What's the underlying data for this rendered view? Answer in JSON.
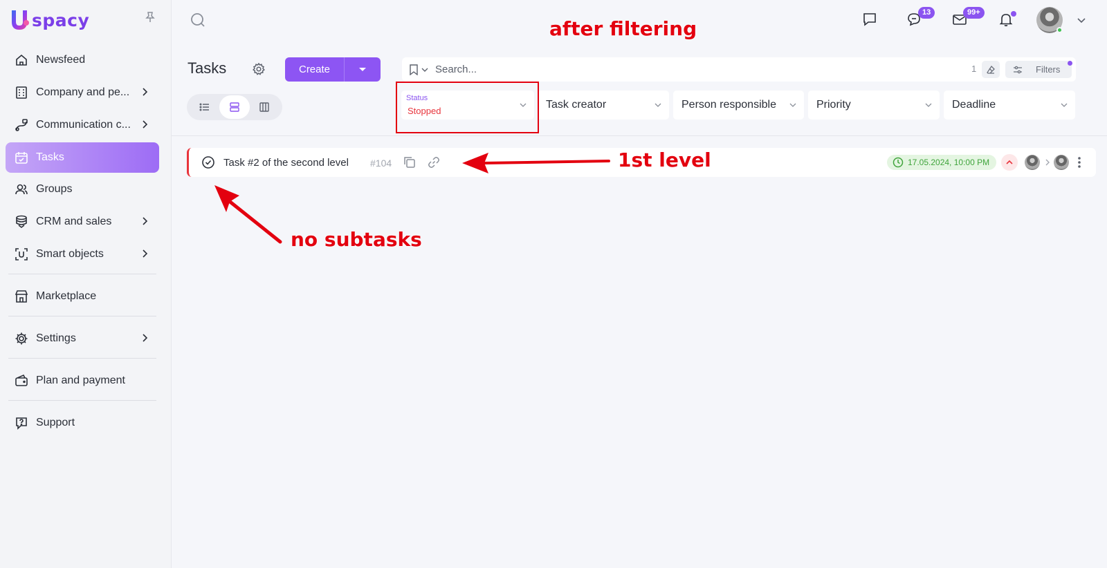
{
  "app": {
    "logo_text": "spacy"
  },
  "sidebar": {
    "items": [
      {
        "label": "Newsfeed"
      },
      {
        "label": "Company and pe..."
      },
      {
        "label": "Communication c..."
      },
      {
        "label": "Tasks"
      },
      {
        "label": "Groups"
      },
      {
        "label": "CRM and sales"
      },
      {
        "label": "Smart objects"
      },
      {
        "label": "Marketplace"
      },
      {
        "label": "Settings"
      },
      {
        "label": "Plan and payment"
      },
      {
        "label": "Support"
      }
    ]
  },
  "topbar": {
    "chat_badge": "13",
    "mail_badge": "99+"
  },
  "page": {
    "title": "Tasks",
    "create_label": "Create"
  },
  "search": {
    "placeholder": "Search...",
    "count": "1",
    "filters_label": "Filters"
  },
  "filters": {
    "status_label": "Status",
    "status_value": "Stopped",
    "task_creator": "Task creator",
    "person_responsible": "Person responsible",
    "priority": "Priority",
    "deadline": "Deadline"
  },
  "task": {
    "title": "Task #2 of the second level",
    "id": "#104",
    "deadline": "17.05.2024, 10:00 PM"
  },
  "annotations": {
    "after_filtering": "after filtering",
    "first_level": "1st level",
    "no_subtasks": "no subtasks"
  },
  "colors": {
    "accent": "#8d55f3",
    "annotation": "#e3000f",
    "stopped": "#e8343c",
    "deadline_ok": "#3fa43b"
  }
}
